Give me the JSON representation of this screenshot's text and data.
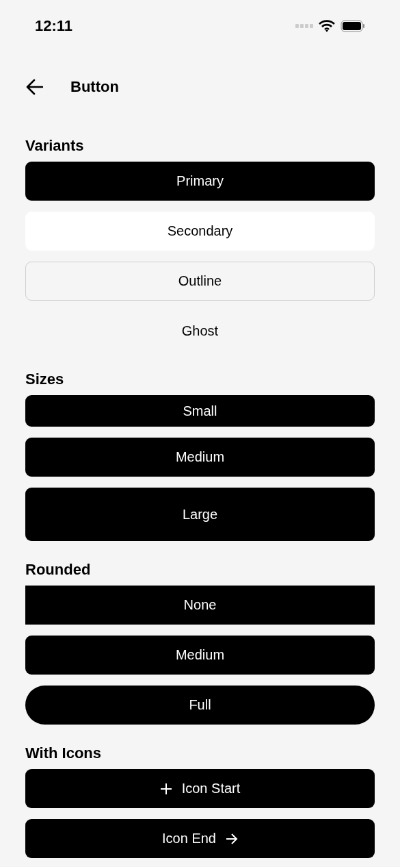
{
  "status_bar": {
    "time": "12:11"
  },
  "header": {
    "title": "Button"
  },
  "sections": [
    {
      "title": "Variants",
      "buttons": [
        {
          "label": "Primary",
          "kind": "primary"
        },
        {
          "label": "Secondary",
          "kind": "secondary"
        },
        {
          "label": "Outline",
          "kind": "outline"
        },
        {
          "label": "Ghost",
          "kind": "ghost"
        }
      ]
    },
    {
      "title": "Sizes",
      "buttons": [
        {
          "label": "Small",
          "kind": "small"
        },
        {
          "label": "Medium",
          "kind": "primary"
        },
        {
          "label": "Large",
          "kind": "large"
        }
      ]
    },
    {
      "title": "Rounded",
      "buttons": [
        {
          "label": "None",
          "kind": "square"
        },
        {
          "label": "Medium",
          "kind": "primary"
        },
        {
          "label": "Full",
          "kind": "pill"
        }
      ]
    },
    {
      "title": "With Icons",
      "buttons": [
        {
          "label": "Icon Start",
          "kind": "leading"
        },
        {
          "label": "Icon End",
          "kind": "trailing"
        }
      ]
    }
  ]
}
